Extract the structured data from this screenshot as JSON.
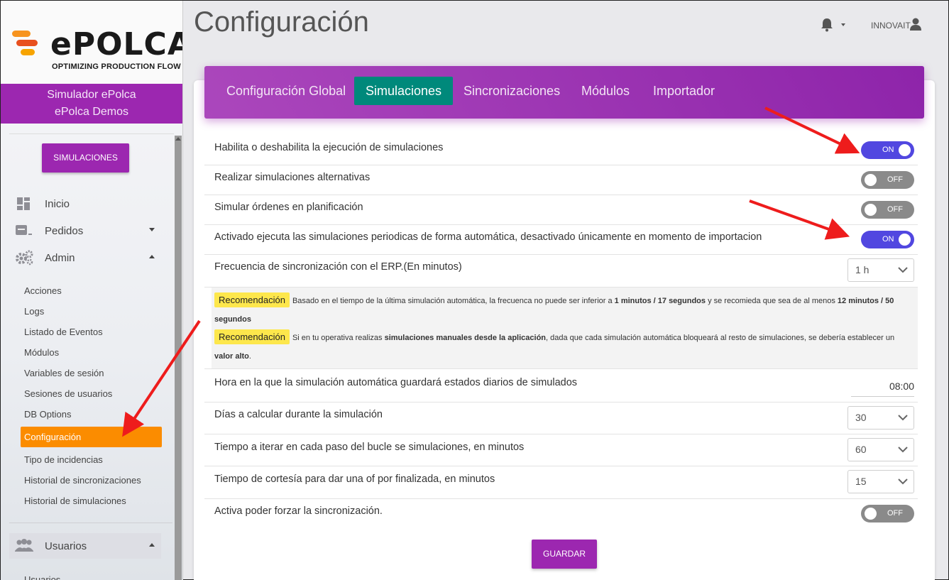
{
  "brand": {
    "logo_text": "ePOLCA",
    "logo_sub": "OPTIMIZING PRODUCTION FLOW"
  },
  "company": {
    "line1": "Simulador ePolca",
    "line2": "ePolca Demos"
  },
  "sidebar": {
    "sim_button": "SIMULACIONES",
    "nav": [
      {
        "label": "Inicio",
        "icon": "dashboard-icon"
      },
      {
        "label": "Pedidos",
        "icon": "inbox-icon"
      },
      {
        "label": "Admin",
        "icon": "gears-icon"
      }
    ],
    "admin_items": [
      "Acciones",
      "Logs",
      "Listado de Eventos",
      "Módulos",
      "Variables de sesión",
      "Sesiones de usuarios",
      "DB Options"
    ],
    "active_item": "Configuración",
    "admin_items_after": [
      "Tipo de incidencias",
      "Historial de sincronizaciones",
      "Historial de simulaciones"
    ],
    "users_section": "Usuarios",
    "users_sub": "Usuarios"
  },
  "header": {
    "title": "Configuración",
    "user": "INNOVAIT"
  },
  "tabs": [
    "Configuración Global",
    "Simulaciones",
    "Sincronizaciones",
    "Módulos",
    "Importador"
  ],
  "active_tab": "Simulaciones",
  "settings": {
    "enable_sim": {
      "label": "Habilita o deshabilita la ejecución de simulaciones",
      "state": "ON"
    },
    "alt_sim": {
      "label": "Realizar simulaciones alternativas",
      "state": "OFF"
    },
    "plan_orders": {
      "label": "Simular órdenes en planificación",
      "state": "OFF"
    },
    "periodic": {
      "label": "Activado ejecuta las simulaciones periodicas de forma automática, desactivado únicamente en momento de importacion",
      "state": "ON"
    },
    "sync_freq": {
      "label": "Frecuencia de sincronización con el ERP.(En minutos)",
      "value": "1 h"
    },
    "save_hour": {
      "label": "Hora en la que la simulación automática guardará estados diarios de simulados",
      "value": "08:00"
    },
    "days": {
      "label": "Días a calcular durante la simulación",
      "value": "30"
    },
    "iter": {
      "label": "Tiempo a iterar en cada paso del bucle se simulaciones, en minutos",
      "value": "60"
    },
    "courtesy": {
      "label": "Tiempo de cortesía para dar una of por finalizada, en minutos",
      "value": "15"
    },
    "force_sync": {
      "label": "Activa poder forzar la sincronización.",
      "state": "OFF"
    }
  },
  "reco": {
    "badge": "Recomendación",
    "r1_a": "Basado en el tiempo de la última simulación automática, la frecuenca no puede ser inferior a ",
    "r1_b": "1 minutos / 17 segundos",
    "r1_c": " y se recomieda que sea de al menos ",
    "r1_d": "12 minutos / 50 segundos",
    "r2_a": "Si en tu operativa realizas ",
    "r2_b": "simulaciones manuales desde la aplicación",
    "r2_c": ", dada que cada simulación automática bloqueará al resto de simulaciones, se debería establecer un ",
    "r2_d": "valor alto",
    "r2_e": "."
  },
  "save_button": "GUARDAR",
  "colors": {
    "purple": "#9c27b0",
    "teal": "#00897b",
    "orange": "#fb8c00",
    "toggle_on": "#5147e0",
    "arrow": "#ee1c1c"
  }
}
